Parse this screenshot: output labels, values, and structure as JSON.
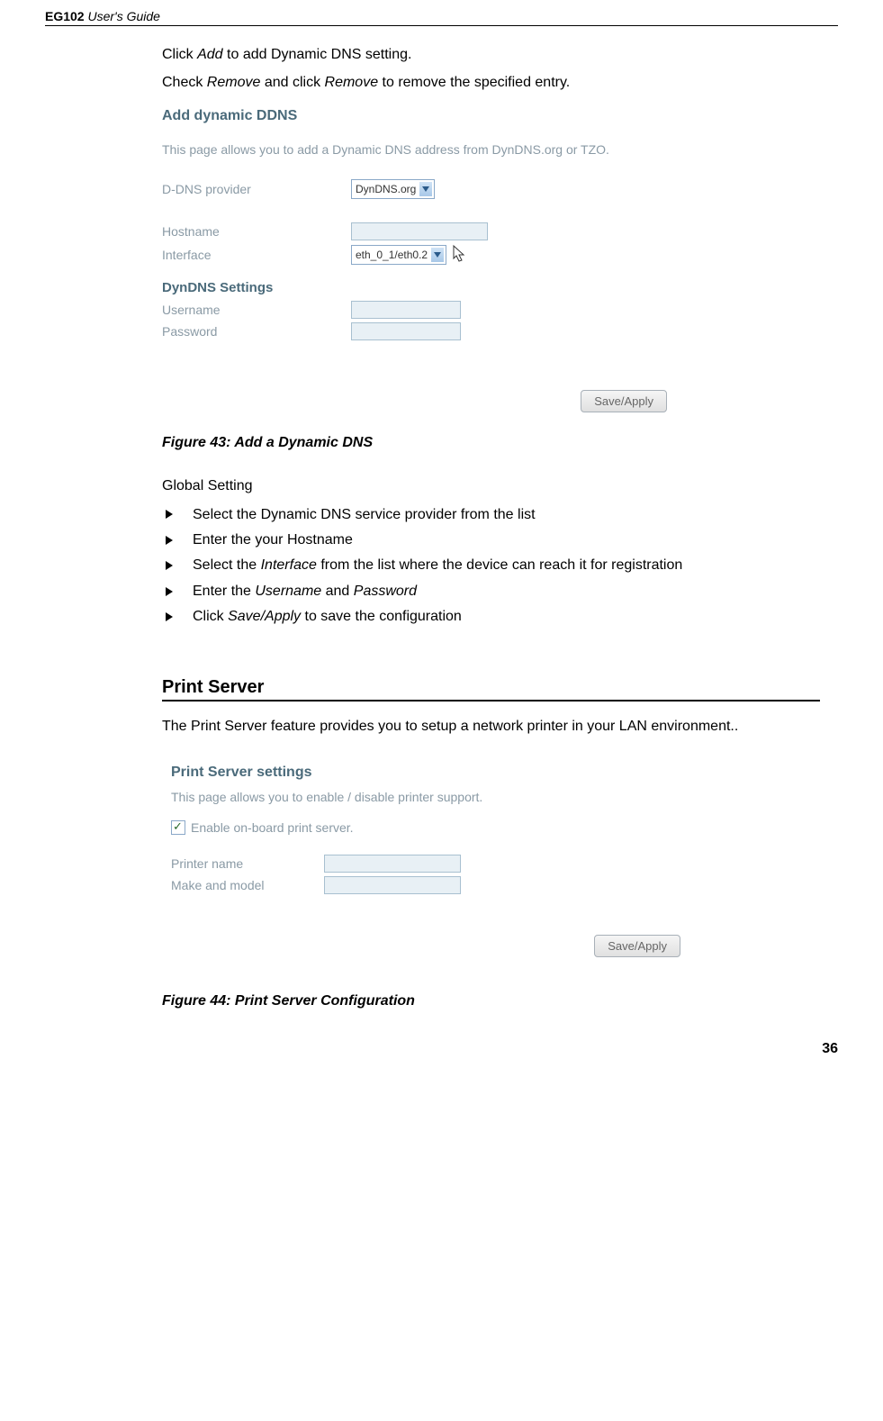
{
  "header": {
    "product": "EG102",
    "suffix": "User's Guide"
  },
  "intro": {
    "line1_pre": "Click ",
    "line1_em": "Add",
    "line1_post": " to add Dynamic DNS setting.",
    "line2_pre": "Check ",
    "line2_em1": "Remove",
    "line2_mid": " and click ",
    "line2_em2": "Remove",
    "line2_post": " to remove the specified entry."
  },
  "screenshot1": {
    "title": "Add dynamic DDNS",
    "desc": "This page allows you to add a Dynamic DNS address from DynDNS.org or TZO.",
    "rows": {
      "provider_label": "D-DNS provider",
      "provider_value": "DynDNS.org",
      "hostname_label": "Hostname",
      "interface_label": "Interface",
      "interface_value": "eth_0_1/eth0.2"
    },
    "subsection": "DynDNS Settings",
    "username_label": "Username",
    "password_label": "Password",
    "apply_label": "Save/Apply"
  },
  "figure43": "Figure 43: Add a Dynamic DNS",
  "global_setting_title": "Global Setting",
  "bullets": [
    {
      "text": "Select the Dynamic DNS service provider from the list"
    },
    {
      "text": "Enter the your Hostname"
    },
    {
      "pre": "Select the ",
      "em": "Interface",
      "post": " from the list where the device can reach it for registration"
    },
    {
      "pre": "Enter the ",
      "em": "Username",
      "mid": " and ",
      "em2": "Password"
    },
    {
      "pre": "Click ",
      "em": "Save/Apply",
      "post": " to save the configuration"
    }
  ],
  "print_server_heading": "Print Server",
  "print_server_desc": "The Print Server feature provides you to setup a network printer in your LAN environment..",
  "screenshot2": {
    "title": "Print Server settings",
    "desc": "This page allows you to enable / disable printer support.",
    "checkbox_label": "Enable on-board print server.",
    "printer_name_label": "Printer name",
    "make_model_label": "Make and model",
    "apply_label": "Save/Apply"
  },
  "figure44": "Figure 44: Print Server Configuration",
  "page_number": "36"
}
